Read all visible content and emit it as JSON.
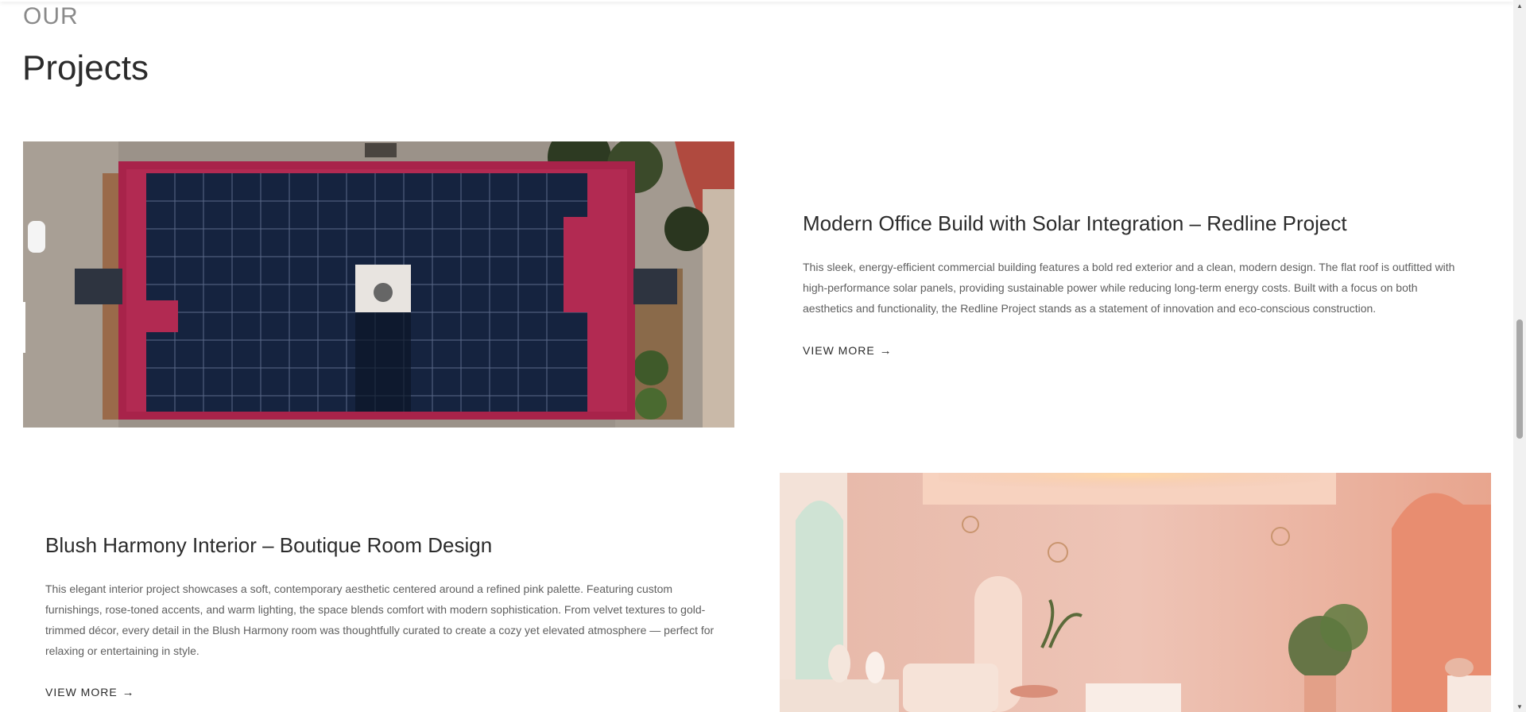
{
  "section": {
    "eyebrow": "OUR",
    "title": "Projects"
  },
  "projects": [
    {
      "title": "Modern Office Build with Solar Integration – Redline Project",
      "description": "This sleek, energy-efficient commercial building features a bold red exterior and a clean, modern design. The flat roof is outfitted with high-performance solar panels, providing sustainable power while reducing long-term energy costs. Built with a focus on both aesthetics and functionality, the Redline Project stands as a statement of innovation and eco-conscious construction.",
      "cta": "VIEW MORE",
      "cta_icon": "→",
      "image": "aerial-red-building-solar-roof"
    },
    {
      "title": "Blush Harmony Interior – Boutique Room Design",
      "description": "This elegant interior project showcases a soft, contemporary aesthetic centered around a refined pink palette. Featuring custom furnishings, rose-toned accents, and warm lighting, the space blends comfort with modern sophistication. From velvet textures to gold-trimmed décor, every detail in the Blush Harmony room was thoughtfully curated to create a cozy yet elevated atmosphere — perfect for relaxing or entertaining in style.",
      "cta": "VIEW MORE",
      "cta_icon": "→",
      "image": "pink-boutique-room-interior"
    }
  ],
  "scrollbar": {
    "up_icon": "▲",
    "down_icon": "▼"
  }
}
